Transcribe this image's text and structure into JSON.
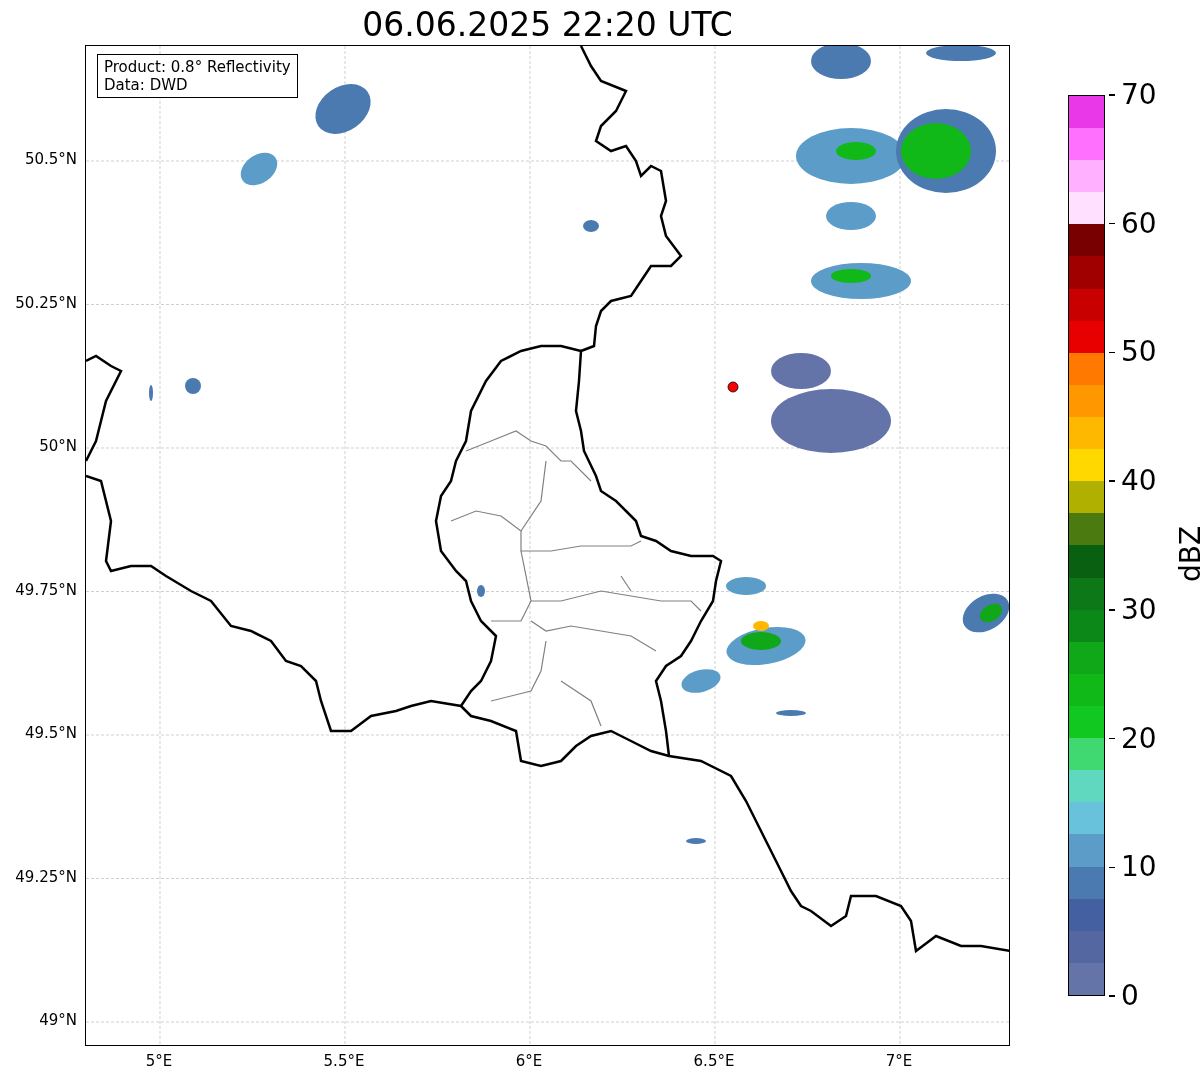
{
  "title": "06.06.2025 22:20 UTC",
  "info_box": {
    "lines": [
      "Product: 0.8° Reflectivity",
      "Data: DWD"
    ]
  },
  "map": {
    "x_tick_labels": [
      "5°E",
      "5.5°E",
      "6°E",
      "6.5°E",
      "7°E"
    ],
    "y_tick_labels": [
      "50.5°N",
      "50.25°N",
      "50°N",
      "49.75°N",
      "49.5°N",
      "49.25°N",
      "49°N"
    ],
    "marker": {
      "color": "#ff0000"
    }
  },
  "colorbar": {
    "label": "dBZ",
    "ticks": [
      "70",
      "60",
      "50",
      "40",
      "30",
      "20",
      "10",
      "0"
    ],
    "bands": [
      {
        "color": "#6574a8"
      },
      {
        "color": "#5467a0"
      },
      {
        "color": "#4560a0"
      },
      {
        "color": "#4b7ab0"
      },
      {
        "color": "#5b9dc8"
      },
      {
        "color": "#68c2dc"
      },
      {
        "color": "#60d8c0"
      },
      {
        "color": "#40d870"
      },
      {
        "color": "#10c820"
      },
      {
        "color": "#10b818"
      },
      {
        "color": "#10a818"
      },
      {
        "color": "#0c8818"
      },
      {
        "color": "#0c7818"
      },
      {
        "color": "#086010"
      },
      {
        "color": "#4a7a10"
      },
      {
        "color": "#b0b000"
      },
      {
        "color": "#ffd800"
      },
      {
        "color": "#ffb800"
      },
      {
        "color": "#ff9800"
      },
      {
        "color": "#ff7800"
      },
      {
        "color": "#e80000"
      },
      {
        "color": "#c80000"
      },
      {
        "color": "#a00000"
      },
      {
        "color": "#780000"
      },
      {
        "color": "#ffe0ff"
      },
      {
        "color": "#ffb0ff"
      },
      {
        "color": "#ff70ff"
      },
      {
        "color": "#e838e8"
      }
    ]
  }
}
